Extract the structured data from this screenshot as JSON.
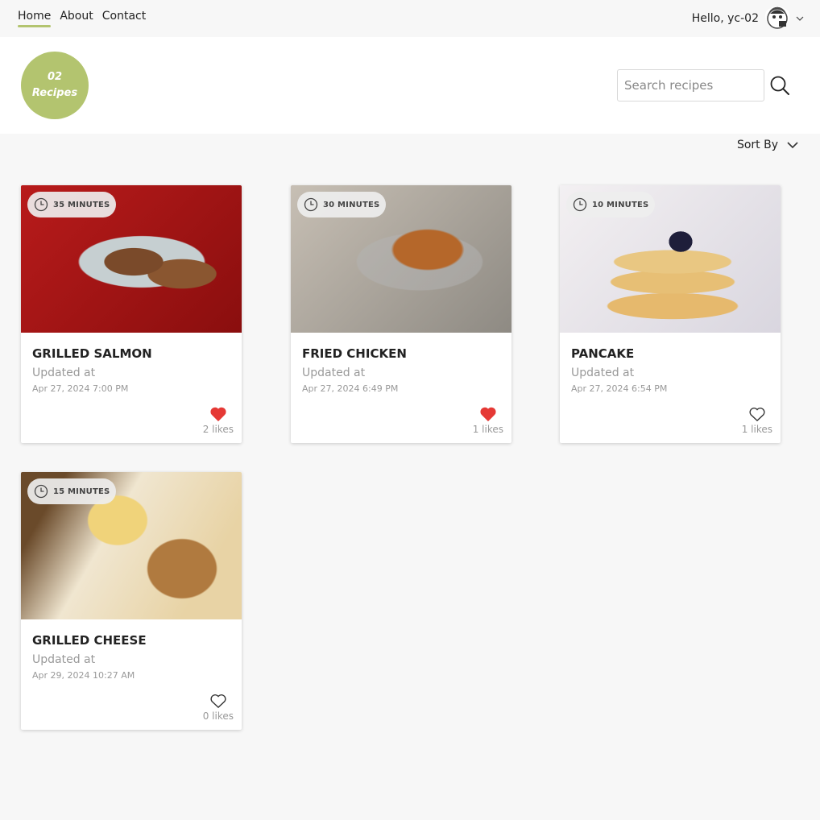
{
  "nav": {
    "links": [
      {
        "label": "Home",
        "active": true
      },
      {
        "label": "About",
        "active": false
      },
      {
        "label": "Contact",
        "active": false
      }
    ],
    "greeting": "Hello, yc-02"
  },
  "header": {
    "badge_line1": "02",
    "badge_line2": "Recipes",
    "search_placeholder": "Search recipes",
    "accent_color": "#b3c46f"
  },
  "sort": {
    "label": "Sort By"
  },
  "recipes": [
    {
      "time": "35 MINUTES",
      "title": "GRILLED SALMON",
      "updated_label": "Updated at",
      "date": "Apr 27, 2024 7:00 PM",
      "liked": true,
      "likes": "2 likes",
      "image": "grilled-salmon"
    },
    {
      "time": "30 MINUTES",
      "title": "FRIED CHICKEN",
      "updated_label": "Updated at",
      "date": "Apr 27, 2024 6:49 PM",
      "liked": true,
      "likes": "1 likes",
      "image": "fried-chicken"
    },
    {
      "time": "10 MINUTES",
      "title": "PANCAKE",
      "updated_label": "Updated at",
      "date": "Apr 27, 2024 6:54 PM",
      "liked": false,
      "likes": "1 likes",
      "image": "pancake"
    },
    {
      "time": "15 MINUTES",
      "title": "GRILLED CHEESE",
      "updated_label": "Updated at",
      "date": "Apr 29, 2024 10:27 AM",
      "liked": false,
      "likes": "0 likes",
      "image": "grilled-cheese"
    }
  ]
}
